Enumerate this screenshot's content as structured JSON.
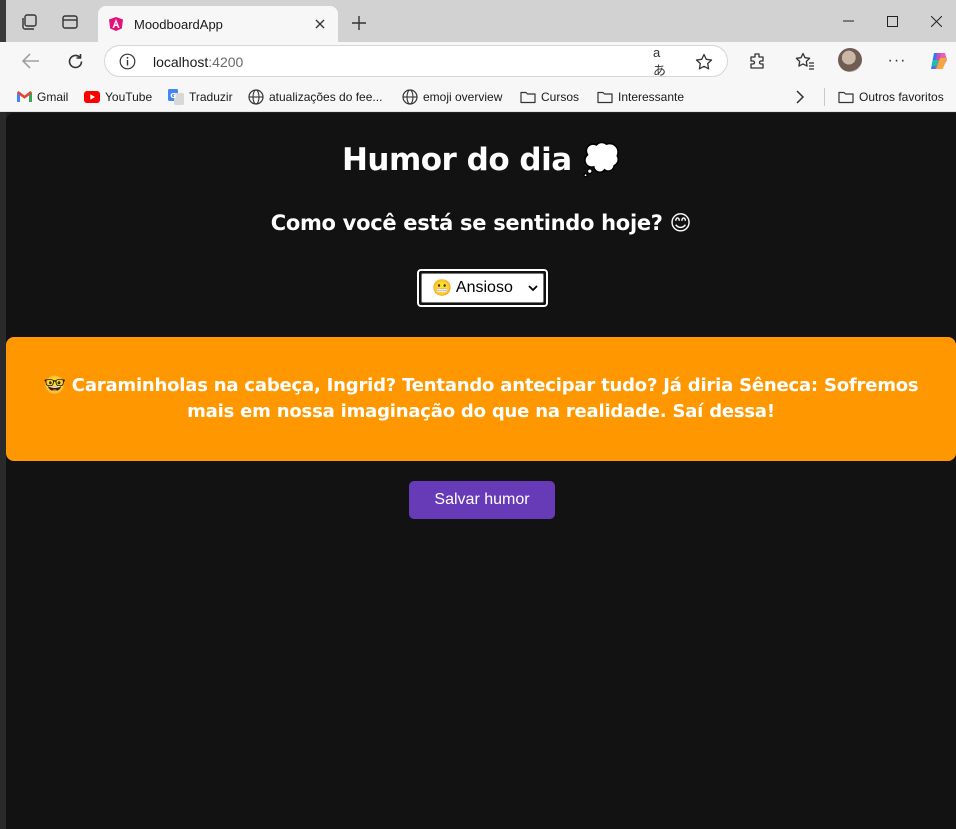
{
  "browser": {
    "tab_title": "MoodboardApp",
    "url_host": "localhost",
    "url_port": ":4200",
    "bookmarks": [
      {
        "label": "Gmail",
        "icon": "gmail-icon"
      },
      {
        "label": "YouTube",
        "icon": "youtube-icon"
      },
      {
        "label": "Traduzir",
        "icon": "translate-icon"
      },
      {
        "label": "atualizações do fee...",
        "icon": "globe-icon"
      },
      {
        "label": "emoji overview",
        "icon": "globe-icon"
      },
      {
        "label": "Cursos",
        "icon": "folder-icon"
      },
      {
        "label": "Interessante",
        "icon": "folder-icon"
      }
    ],
    "other_favorites": "Outros favoritos"
  },
  "app": {
    "title": "Humor do dia 💭",
    "question": "Como você está se sentindo hoje? 😊",
    "mood_select": {
      "selected_emoji": "😬",
      "selected_label": "Ansioso"
    },
    "message": "🤓 Caraminholas na cabeça, Ingrid? Tentando antecipar tudo? Já diria Sêneca: Sofremos mais em nossa imaginação do que na realidade. Saí dessa!",
    "save_label": "Salvar humor"
  },
  "colors": {
    "page_bg": "#121212",
    "message_bg": "#ff9800",
    "button_bg": "#673ab7"
  }
}
